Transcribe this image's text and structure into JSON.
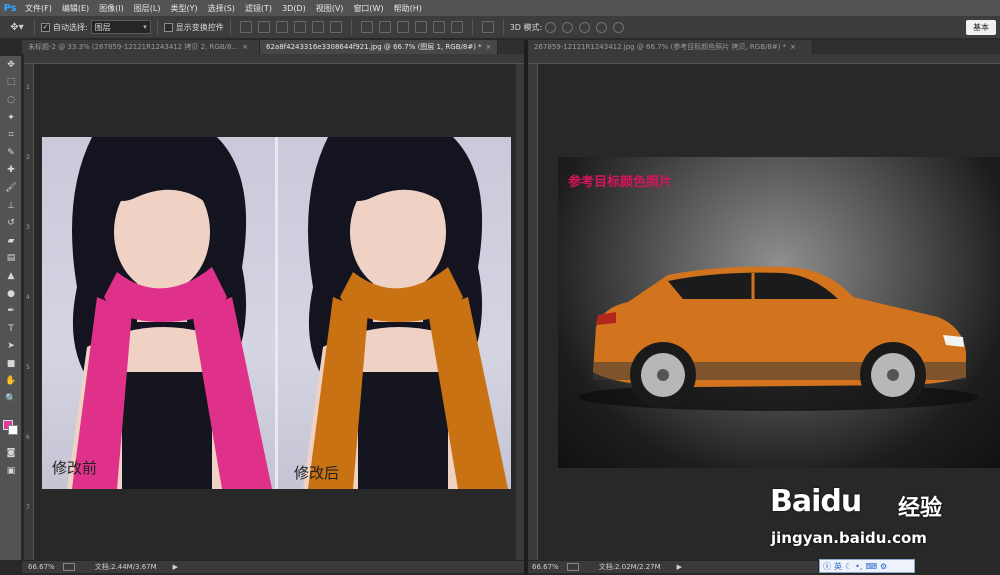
{
  "app": {
    "logo": "Ps"
  },
  "menu": [
    "文件(F)",
    "编辑(E)",
    "图像(I)",
    "图层(L)",
    "类型(Y)",
    "选择(S)",
    "滤镜(T)",
    "3D(D)",
    "视图(V)",
    "窗口(W)",
    "帮助(H)"
  ],
  "options": {
    "auto_select_label": "自动选择:",
    "auto_select_checked": true,
    "auto_select_value": "图层",
    "show_transform_label": "显示变换控件",
    "mode_label": "3D 模式:",
    "workspace_label": "基本"
  },
  "tabs_left": [
    {
      "label": "未标题-2 @ 33.3% (267859-12121R1243412 拷贝 2, RGB/8...",
      "active": false,
      "close": "×"
    },
    {
      "label": "62a8f4243316e3308644f921.jpg @ 66.7% (图层 1, RGB/8#) *",
      "active": true,
      "close": "×"
    }
  ],
  "tabs_right": [
    {
      "label": "267859-12121R1243412.jpg @ 66.7% (参考目标颜色照片 拷贝, RGB/8#) *",
      "active": false,
      "close": "×"
    }
  ],
  "ruler_left_numbers": [
    "1",
    "2",
    "3",
    "4",
    "5",
    "6",
    "7"
  ],
  "doc1": {
    "caption_before": "修改前",
    "caption_after": "修改后",
    "scarf_before_color": "#e0318a",
    "scarf_after_color": "#c97214"
  },
  "doc2": {
    "title": "参考目标颜色照片",
    "title_color": "#d6145c",
    "car_color": "#d2741e"
  },
  "status_left": {
    "zoom": "66.67%",
    "doc": "文档:2.44M/3.67M"
  },
  "status_right": {
    "zoom": "66.67%",
    "doc": "文档:2.02M/2.27M"
  },
  "watermark": {
    "brand": "Baidu",
    "brand_cn": "经验",
    "url": "jingyan.baidu.com"
  },
  "ime": {
    "label": "英"
  },
  "colors": {
    "foreground": "#e03c97",
    "background": "#ffffff"
  }
}
